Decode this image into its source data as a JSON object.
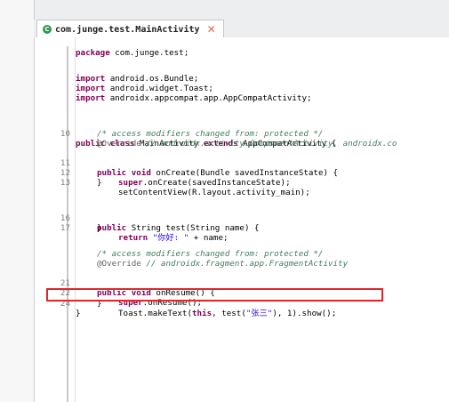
{
  "tab": {
    "title": "com.junge.test.MainActivity",
    "icon": "class-c-icon",
    "close_icon": "close-x-icon"
  },
  "code": {
    "l_package": "package com.junge.test;",
    "l_imp1": [
      "import",
      " android.os.Bundle;"
    ],
    "l_imp2": [
      "import",
      " android.widget.Toast;"
    ],
    "l_imp3": [
      "import",
      " androidx.appcompat.app.AppCompatActivity;"
    ],
    "l10": {
      "ln": "10",
      "t": [
        "public",
        " ",
        "class",
        " MainActivity ",
        "extends",
        " AppCompatActivity {"
      ]
    },
    "lc1": "/* access modifiers changed from: protected */",
    "lo1": [
      "@Override",
      " // androidx.activity.ComponentActivity, androidx.co"
    ],
    "l11": {
      "ln": "11",
      "t": [
        "public",
        " ",
        "void",
        " onCreate(Bundle savedInstanceState) {"
      ]
    },
    "l12": {
      "ln": "12",
      "t": [
        "super",
        ".onCreate(savedInstanceState);"
      ]
    },
    "l13": {
      "ln": "13",
      "t": "setContentView(R.layout.activity_main);"
    },
    "lb1": "}",
    "l16": {
      "ln": "16",
      "t": [
        "public",
        " String test(String name) {"
      ]
    },
    "l17": {
      "ln": "17",
      "t": [
        "return",
        " ",
        "\"你好: \"",
        " + name;"
      ]
    },
    "lb2": "}",
    "lc2": "/* access modifiers changed from: protected */",
    "lo2": [
      "@Override",
      " // androidx.fragment.app.FragmentActivity"
    ],
    "l21": {
      "ln": "21",
      "t": [
        "public",
        " ",
        "void",
        " onResume() {"
      ]
    },
    "l22": {
      "ln": "22",
      "t": [
        "super",
        ".onResume();"
      ]
    },
    "l24": {
      "ln": "24",
      "t": [
        "Toast.makeText(",
        "this",
        ", test(",
        "\"张三\"",
        "), 1).show();"
      ]
    },
    "lb3": "}",
    "lb4": "}"
  },
  "colors": {
    "keyword": "#7f0055",
    "comment": "#3f7f5f",
    "string": "#2a00ff",
    "highlight": "#e0262b"
  }
}
